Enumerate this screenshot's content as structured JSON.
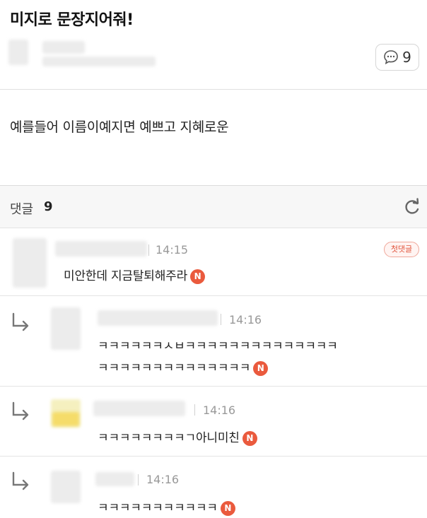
{
  "post": {
    "title": "미지로 문장지어줘!",
    "comment_count": "9",
    "body": "예를들어 이름이예지면 예쁘고 지혜로운"
  },
  "comments_section": {
    "label": "댓글",
    "count": "9"
  },
  "badges": {
    "first_comment": "첫댓글",
    "new": "N"
  },
  "comments": [
    {
      "time": "14:15",
      "text": "미안한데 지금탈퇴해주라"
    },
    {
      "time": "14:16",
      "text_line1": "ㅋㅋㅋㅋㅋㅋㅅㅂㅋㅋㅋㅋㅋㅋㅋㅋㅋㅋㅋㅋㅋㅋ",
      "text_line2": "ㅋㅋㅋㅋㅋㅋㅋㅋㅋㅋㅋㅋㅋㅋ"
    },
    {
      "time": "14:16",
      "text": "ㅋㅋㅋㅋㅋㅋㅋㅋㄱ아니미친"
    },
    {
      "time": "14:16",
      "text": "ㅋㅋㅋㅋㅋㅋㅋㅋㅋㅋㅋ"
    }
  ]
}
